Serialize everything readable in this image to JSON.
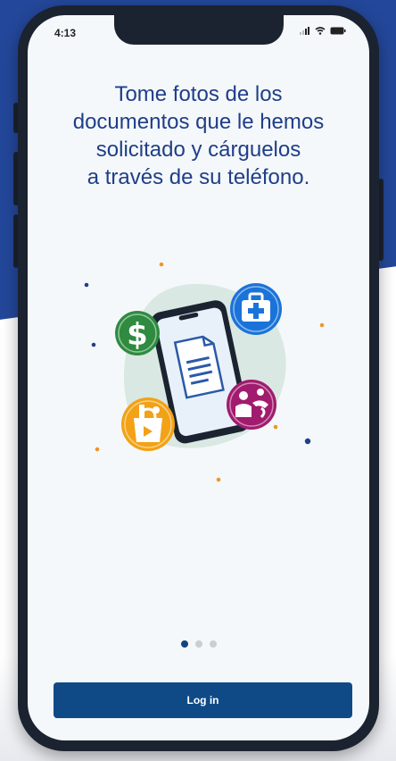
{
  "status_bar": {
    "time": "4:13"
  },
  "onboarding": {
    "headline_lines": [
      "Tome fotos de los",
      "documentos que le hemos",
      "solicitado y cárguelos",
      "a través de su teléfono."
    ],
    "page_indicator": {
      "total": 3,
      "current": 1
    }
  },
  "actions": {
    "login_label": "Log in"
  },
  "colors": {
    "brand_blue": "#23479a",
    "text_blue": "#1f3e8a",
    "button_blue": "#0f4a87",
    "green_badge": "#2e8b3f",
    "blue_badge": "#1a73d9",
    "magenta_badge": "#a11b6e",
    "orange_badge": "#f2a216",
    "background": "#f5f8fa"
  },
  "icons": [
    "dollar-icon",
    "medical-kit-icon",
    "family-icon",
    "grocery-bag-icon",
    "document-icon",
    "phone-icon"
  ]
}
